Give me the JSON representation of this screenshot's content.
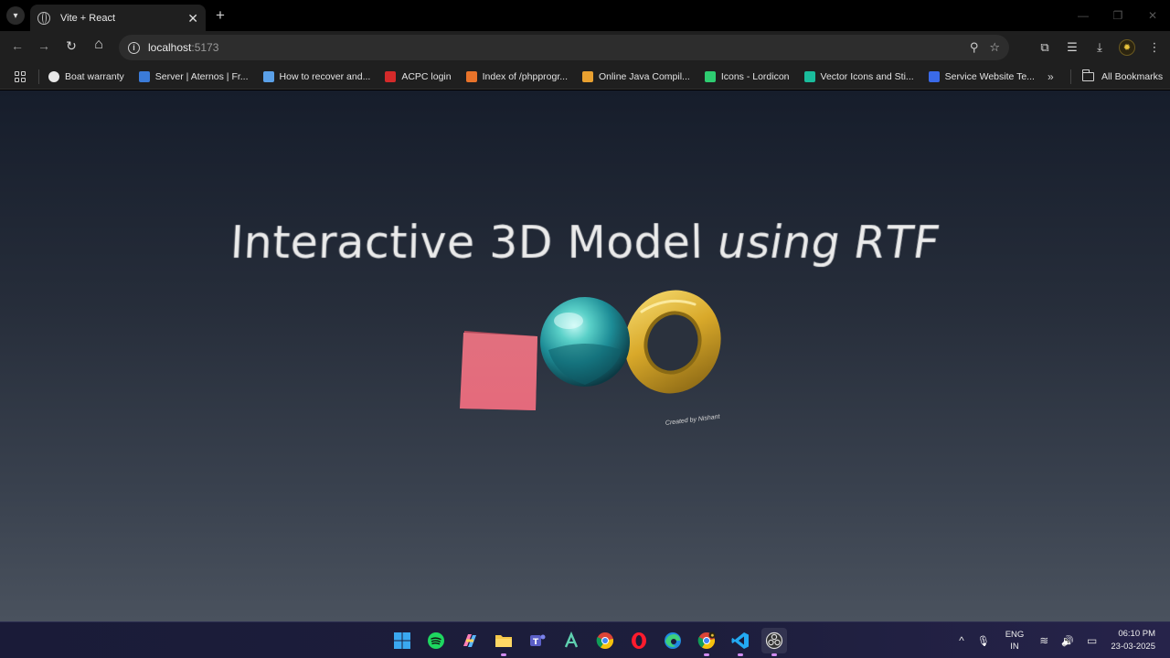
{
  "browser": {
    "tab": {
      "title": "Vite + React",
      "close": "✕"
    },
    "new_tab": "+",
    "window_controls": {
      "minimize": "—",
      "maximize": "❐",
      "close": "✕"
    },
    "nav": {
      "back": "←",
      "forward": "→",
      "reload": "↻",
      "home": "⌂"
    },
    "address": {
      "host": "localhost",
      "port": ":5173"
    },
    "omnibox_icons": {
      "zoom": "⚲",
      "bookmark": "☆"
    },
    "toolbar_icons": {
      "extensions": "⧉",
      "media": "☰",
      "downloads": "⤓",
      "profile": "✹",
      "menu": "⋮"
    },
    "bookmarks": [
      {
        "label": "Boat warranty",
        "color": "#e8e8e8"
      },
      {
        "label": "Server | Aternos | Fr...",
        "color": "#3b7bd8"
      },
      {
        "label": "How to recover and...",
        "color": "#5aa0e8"
      },
      {
        "label": "ACPC login",
        "color": "#d42a2a"
      },
      {
        "label": "Index of /phpprogr...",
        "color": "#e8732a"
      },
      {
        "label": "Online Java Compil...",
        "color": "#e8a030"
      },
      {
        "label": "Icons - Lordicon",
        "color": "#2ecc71"
      },
      {
        "label": "Vector Icons and Sti...",
        "color": "#1abc9c"
      },
      {
        "label": "Service Website Te...",
        "color": "#3a6ae8"
      }
    ],
    "bookmarks_more": "»",
    "all_bookmarks": "All Bookmarks"
  },
  "page": {
    "title_regular": "Interactive 3D Model",
    "title_italic": "using RTF",
    "credit": "Created by Nishant"
  },
  "taskbar": {
    "language": {
      "line1": "ENG",
      "line2": "IN"
    },
    "time": "06:10 PM",
    "date": "23-03-2025",
    "tray_icons": {
      "chevron": "^",
      "mic": "🎙",
      "wifi": "≋",
      "volume": "🔊",
      "battery": "▭"
    }
  }
}
